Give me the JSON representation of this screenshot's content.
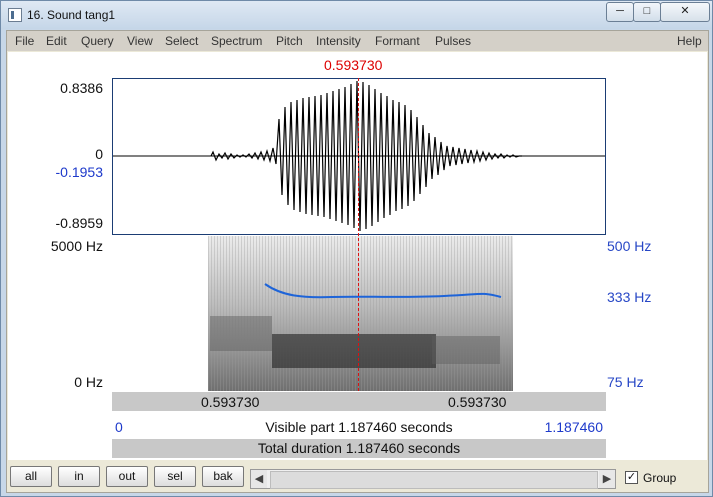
{
  "window": {
    "title": "16. Sound tang1",
    "buttons": {
      "minimize": "─",
      "maximize": "□",
      "close": "✕"
    }
  },
  "menu": {
    "items": [
      "File",
      "Edit",
      "Query",
      "View",
      "Select",
      "Spectrum",
      "Pitch",
      "Intensity",
      "Formant",
      "Pulses"
    ],
    "help": "Help"
  },
  "editor": {
    "cursor_time": "0.593730",
    "waveform": {
      "labels": {
        "top": "0.8386",
        "zero": "0",
        "mark": "-0.1953",
        "bottom": "-0.8959"
      },
      "stroke": "#000000"
    },
    "spectrogram": {
      "left_labels": {
        "top": "5000 Hz",
        "bottom": "0 Hz"
      },
      "right_labels": {
        "top": "500 Hz",
        "middle": "333 Hz",
        "bottom": "75 Hz"
      }
    },
    "pitch_line_color": "#1e64d8",
    "cursor_color": "#d00000"
  },
  "status": {
    "left_time": "0.593730",
    "right_time": "0.593730",
    "visible_start": "0",
    "visible_end": "1.187460",
    "visible_part": "Visible part 1.187460 seconds",
    "total_duration": "Total duration 1.187460 seconds"
  },
  "controls": {
    "buttons": [
      "all",
      "in",
      "out",
      "sel",
      "bak"
    ],
    "scroll_left": "◀",
    "scroll_right": "▶",
    "group_label": "Group",
    "group_checked": true
  }
}
